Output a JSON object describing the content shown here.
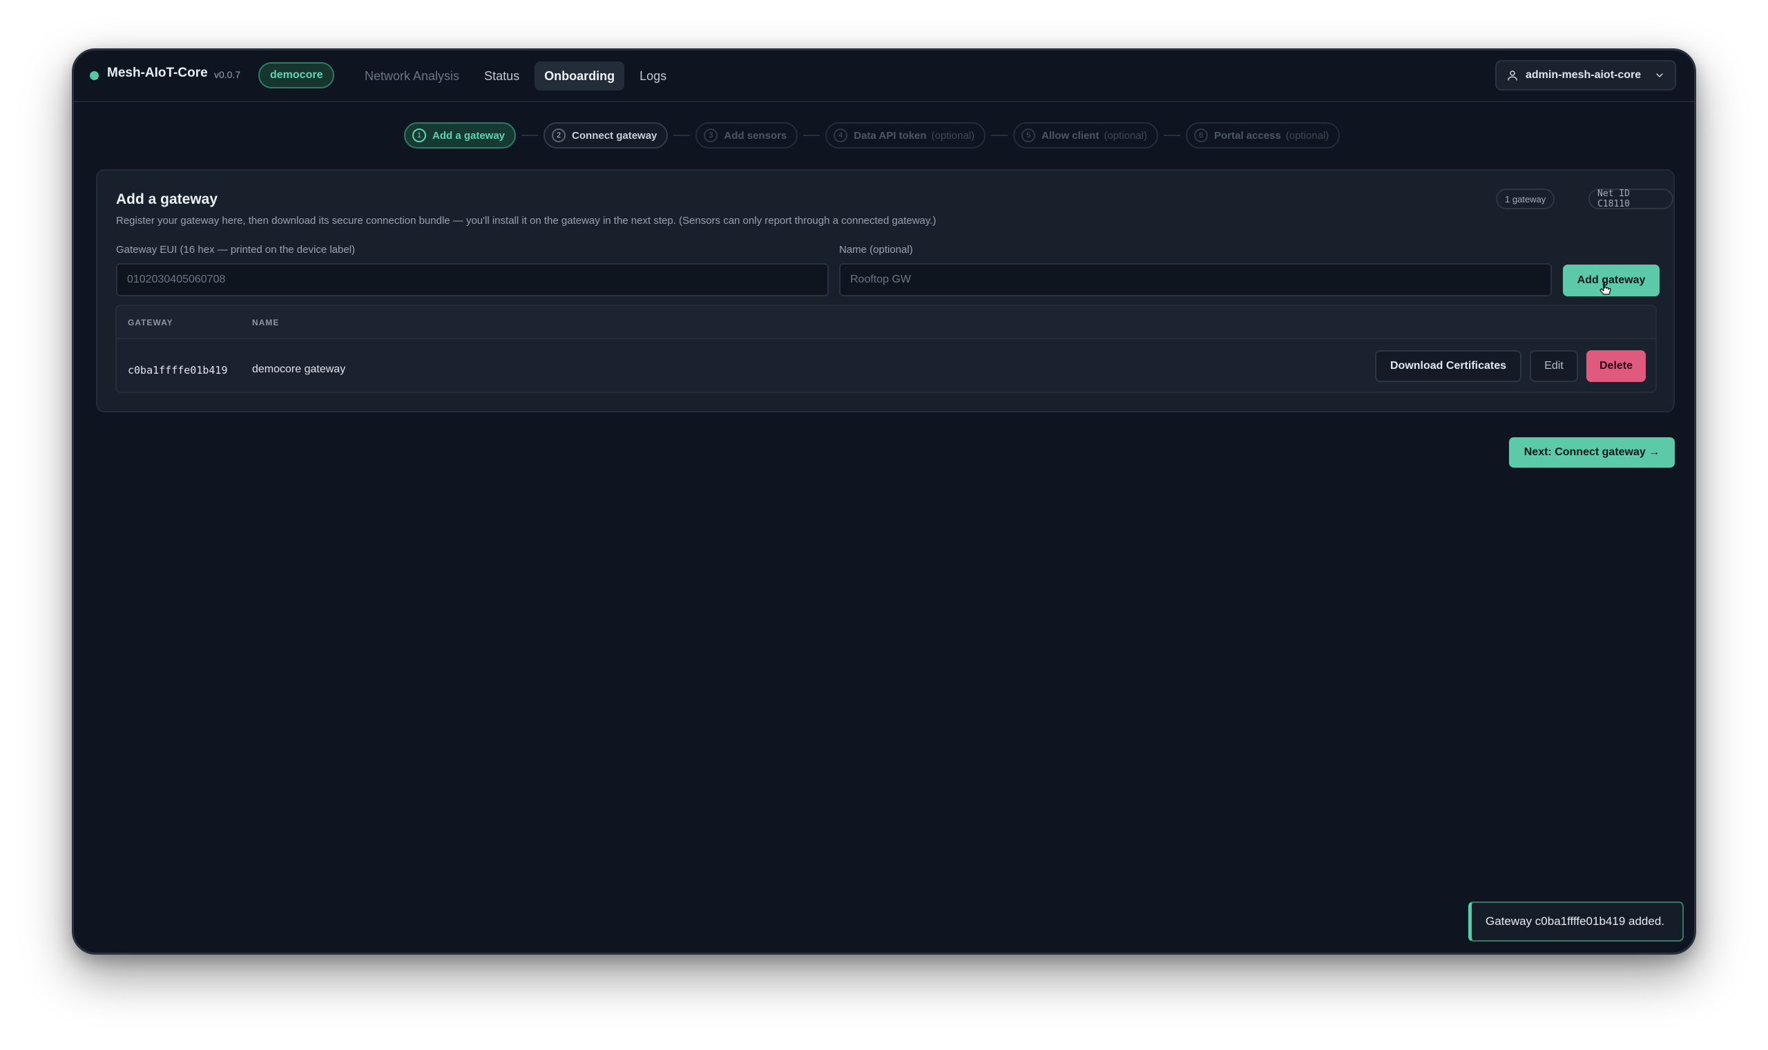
{
  "app": {
    "name": "Mesh-AIoT-Core",
    "version": "v0.0.7",
    "tenant": "democore"
  },
  "nav": {
    "items": [
      {
        "label": "Network Analysis"
      },
      {
        "label": "Status"
      },
      {
        "label": "Onboarding"
      },
      {
        "label": "Logs"
      }
    ],
    "active": "Onboarding"
  },
  "user": {
    "name": "admin-mesh-aiot-core"
  },
  "steps": [
    {
      "num": "1",
      "label": "Add a gateway",
      "optional": ""
    },
    {
      "num": "2",
      "label": "Connect gateway",
      "optional": ""
    },
    {
      "num": "3",
      "label": "Add sensors",
      "optional": ""
    },
    {
      "num": "4",
      "label": "Data API token",
      "optional": "(optional)"
    },
    {
      "num": "5",
      "label": "Allow client",
      "optional": "(optional)"
    },
    {
      "num": "6",
      "label": "Portal access",
      "optional": "(optional)"
    }
  ],
  "card": {
    "title": "Add a gateway",
    "description": "Register your gateway here, then download its secure connection bundle — you'll install it on the gateway in the next step. (Sensors can only report through a connected gateway.)",
    "count_chip": "1 gateway",
    "netid_chip": "Net ID C18110",
    "eui_label": "Gateway EUI (16 hex — printed on the device label)",
    "eui_placeholder": "0102030405060708",
    "name_label": "Name (optional)",
    "name_placeholder": "Rooftop GW",
    "add_button": "Add gateway"
  },
  "table": {
    "columns": [
      "GATEWAY",
      "NAME"
    ],
    "rows": [
      {
        "gateway": "c0ba1ffffe01b419",
        "name": "democore gateway"
      }
    ],
    "download_label": "Download Certificates",
    "edit_label": "Edit",
    "delete_label": "Delete"
  },
  "next_button": "Next: Connect gateway →",
  "toast": "Gateway c0ba1ffffe01b419 added.",
  "colors": {
    "accent": "#5ccaa8",
    "danger": "#e05a7d",
    "background": "#0e1520",
    "card": "#18202c"
  }
}
